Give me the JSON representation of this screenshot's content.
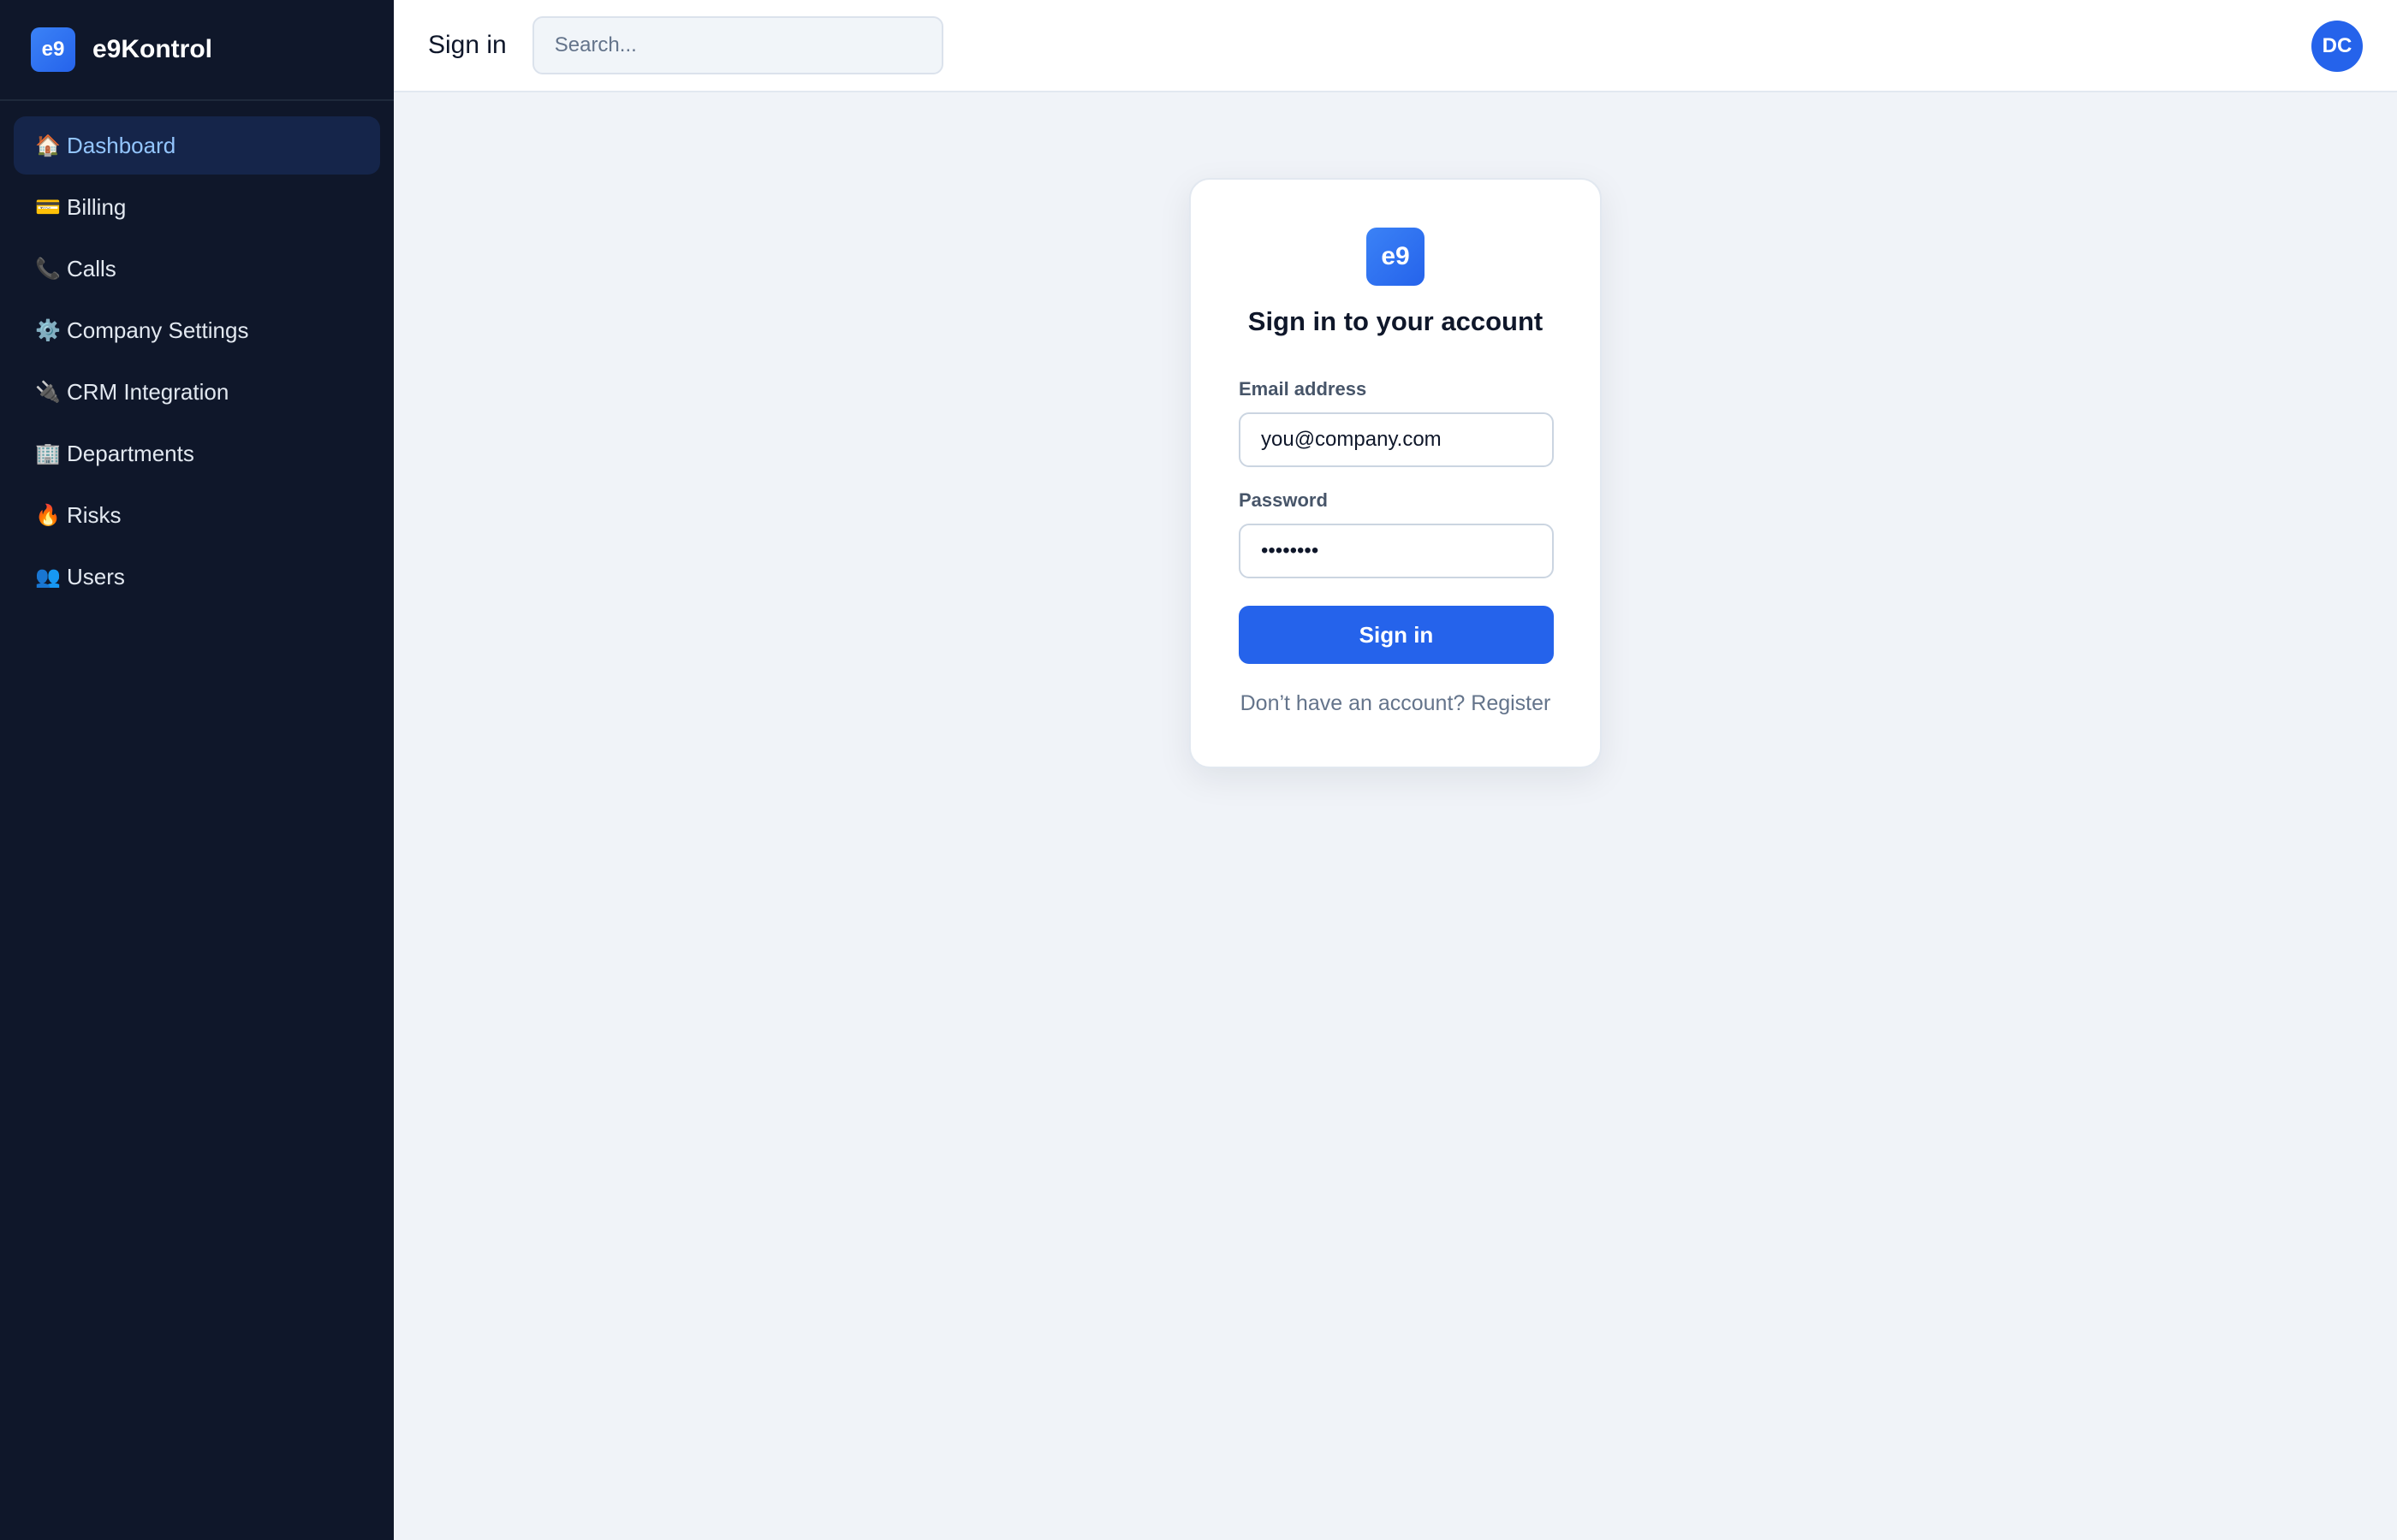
{
  "app": {
    "logo_text": "e9",
    "name": "e9Kontrol"
  },
  "sidebar": {
    "items": [
      {
        "icon": "🏠",
        "icon_name": "house-icon",
        "label": "Dashboard",
        "active": true
      },
      {
        "icon": "💳",
        "icon_name": "credit-card-icon",
        "label": "Billing"
      },
      {
        "icon": "📞",
        "icon_name": "phone-icon",
        "label": "Calls"
      },
      {
        "icon": "⚙️",
        "icon_name": "gear-icon",
        "label": "Company Settings"
      },
      {
        "icon": "🔌",
        "icon_name": "plug-icon",
        "label": "CRM Integration"
      },
      {
        "icon": "🏢",
        "icon_name": "building-icon",
        "label": "Departments"
      },
      {
        "icon": "🔥",
        "icon_name": "fire-icon",
        "label": "Risks"
      },
      {
        "icon": "👥",
        "icon_name": "users-icon",
        "label": "Users"
      }
    ]
  },
  "header": {
    "title": "Sign in",
    "search_placeholder": "Search...",
    "avatar_initials": "DC"
  },
  "login": {
    "logo_text": "e9",
    "title": "Sign in to your account",
    "email_label": "Email address",
    "email_value": "you@company.com",
    "password_label": "Password",
    "password_value": "••••••••",
    "submit_label": "Sign in",
    "register_prompt": "Don’t have an account?",
    "register_link": "Register"
  },
  "colors": {
    "sidebar_bg": "#0f172a",
    "active_item_bg": "#15254a",
    "active_item_text": "#93c5fd",
    "accent": "#2563eb",
    "page_bg": "#f0f3f8"
  }
}
